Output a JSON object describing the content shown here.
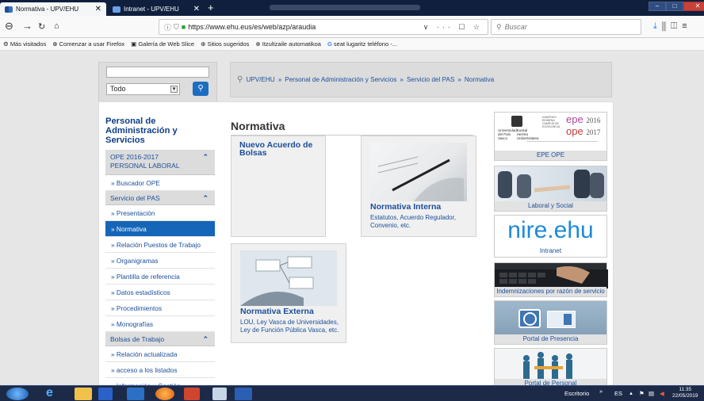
{
  "browser": {
    "tabs": [
      {
        "title": "Normativa - UPV/EHU",
        "active": true
      },
      {
        "title": "Intranet - UPV/EHU",
        "active": false
      }
    ],
    "url": "https://www.ehu.eus/es/web/azp/araudia",
    "search_placeholder": "Buscar",
    "bookmarks": [
      "Más visitados",
      "Comenzar a usar Firefox",
      "Galería de Web Slice",
      "Sitios sugeridos",
      "Itzultzaile automatikoa",
      "seat lugaritz teléfono -..."
    ]
  },
  "site": {
    "search": {
      "select_value": "Todo"
    },
    "breadcrumb": [
      "UPV/EHU",
      "Personal de Administración y Servicios",
      "Servicio del PAS",
      "Normativa"
    ],
    "sidebar": {
      "title": "Personal de Administración y Servicios",
      "sections": [
        {
          "header": "OPE 2016-2017 PERSONAL LABORAL",
          "items": [
            "» Buscador OPE"
          ]
        },
        {
          "header": "Servicio del PAS",
          "items": [
            "» Presentación",
            "» Normativa",
            "» Relación Puestos de Trabajo",
            "» Organigramas",
            "» Plantilla de referencia",
            "» Datos estadísticos",
            "» Procedimientos",
            "» Monografías"
          ]
        },
        {
          "header": "Bolsas de Trabajo",
          "items": [
            "» Relación actualizada",
            "» acceso a los listados",
            "» Información y Gestión"
          ]
        }
      ]
    },
    "main": {
      "title": "Normativa",
      "cards": [
        {
          "title": "Nuevo Acuerdo de Bolsas",
          "desc": ""
        },
        {
          "title": "Normativa Interna",
          "desc": "Estatutos, Acuerdo Regulador, Convenio, etc."
        },
        {
          "title": "Normativa Externa",
          "desc": "LOU, Ley Vasca de Universidades, Ley de Función Pública Vasca, etc."
        }
      ]
    },
    "right": {
      "epe": {
        "caption": "EPE OPE",
        "epe": "epe",
        "epe_year": "2016",
        "ope": "ope",
        "ope_year": "2017"
      },
      "laboral": {
        "caption": "Laboral y Social"
      },
      "intranet": {
        "logo": "nire.ehu",
        "caption": "Intranet"
      },
      "indemn": {
        "caption": "Indemnizaciones por razón de servicio"
      },
      "presencia": {
        "caption": "Portal de Presencia"
      },
      "personal": {
        "caption": "Portal de Personal"
      }
    }
  },
  "taskbar": {
    "desktop_label": "Escritorio",
    "lang": "ES",
    "time": "11:35",
    "date": "22/05/2019"
  },
  "colors": {
    "brand_blue": "#1565b8",
    "link_blue": "#1a4e99",
    "title_blue": "#0d3f86"
  }
}
